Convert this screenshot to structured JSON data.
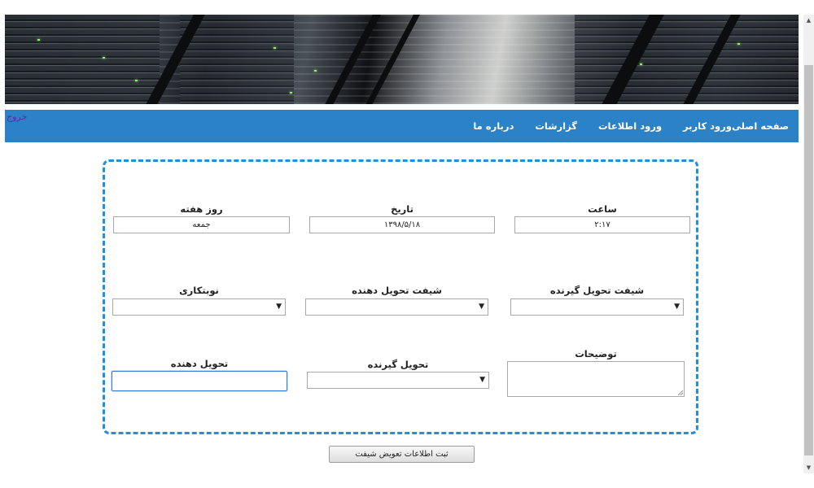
{
  "nav": {
    "logout_label": "خروج",
    "items": [
      {
        "label": "صفحه اصلی"
      },
      {
        "label": "ورود کاربر"
      },
      {
        "label": "ورود اطلاعات"
      },
      {
        "label": "گزارشات"
      },
      {
        "label": "درباره ما"
      }
    ]
  },
  "form": {
    "time_label": "ساعت",
    "time_value": "۲:۱۷",
    "date_label": "تاریخ",
    "date_value": "۱۳۹۸/۵/۱۸",
    "weekday_label": "روز هفته",
    "weekday_value": "جمعه",
    "receiving_shift_label": "شیفت تحویل گیرنده",
    "delivering_shift_label": "شیفت تحویل دهنده",
    "shift_work_label": "نوبتکاری",
    "description_label": "توضیحات",
    "receiver_label": "تحویل گیرنده",
    "deliverer_label": "تحویل دهنده",
    "submit_label": "ثبت اطلاعات تعویض شیفت"
  },
  "colors": {
    "navbar": "#2b82c7",
    "form_border": "#1f8fe0",
    "logout_link": "#5a2aa8"
  },
  "icons": {
    "select_arrow": "triangle-down",
    "scroll_up": "triangle-up",
    "scroll_down": "triangle-down"
  }
}
